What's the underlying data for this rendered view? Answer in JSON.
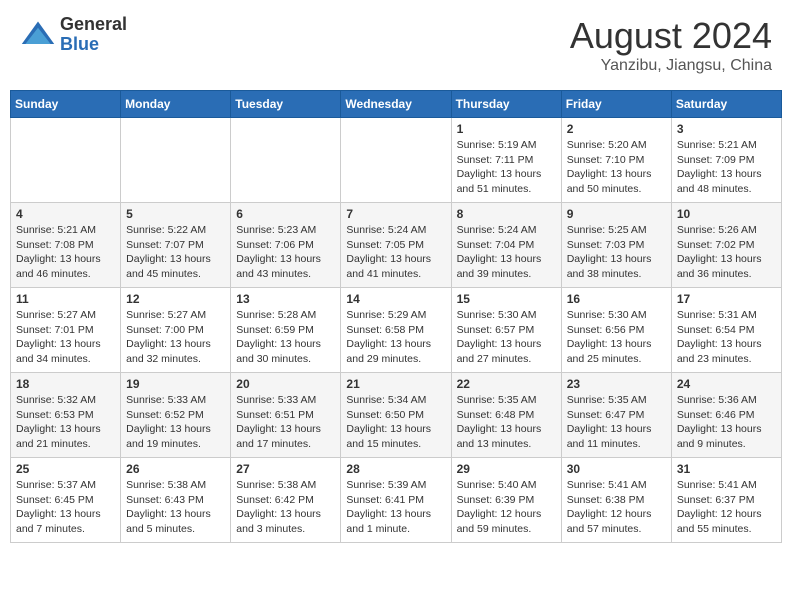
{
  "header": {
    "logo_general": "General",
    "logo_blue": "Blue",
    "month": "August 2024",
    "location": "Yanzibu, Jiangsu, China"
  },
  "weekdays": [
    "Sunday",
    "Monday",
    "Tuesday",
    "Wednesday",
    "Thursday",
    "Friday",
    "Saturday"
  ],
  "weeks": [
    [
      {
        "day": "",
        "info": ""
      },
      {
        "day": "",
        "info": ""
      },
      {
        "day": "",
        "info": ""
      },
      {
        "day": "",
        "info": ""
      },
      {
        "day": "1",
        "info": "Sunrise: 5:19 AM\nSunset: 7:11 PM\nDaylight: 13 hours\nand 51 minutes."
      },
      {
        "day": "2",
        "info": "Sunrise: 5:20 AM\nSunset: 7:10 PM\nDaylight: 13 hours\nand 50 minutes."
      },
      {
        "day": "3",
        "info": "Sunrise: 5:21 AM\nSunset: 7:09 PM\nDaylight: 13 hours\nand 48 minutes."
      }
    ],
    [
      {
        "day": "4",
        "info": "Sunrise: 5:21 AM\nSunset: 7:08 PM\nDaylight: 13 hours\nand 46 minutes."
      },
      {
        "day": "5",
        "info": "Sunrise: 5:22 AM\nSunset: 7:07 PM\nDaylight: 13 hours\nand 45 minutes."
      },
      {
        "day": "6",
        "info": "Sunrise: 5:23 AM\nSunset: 7:06 PM\nDaylight: 13 hours\nand 43 minutes."
      },
      {
        "day": "7",
        "info": "Sunrise: 5:24 AM\nSunset: 7:05 PM\nDaylight: 13 hours\nand 41 minutes."
      },
      {
        "day": "8",
        "info": "Sunrise: 5:24 AM\nSunset: 7:04 PM\nDaylight: 13 hours\nand 39 minutes."
      },
      {
        "day": "9",
        "info": "Sunrise: 5:25 AM\nSunset: 7:03 PM\nDaylight: 13 hours\nand 38 minutes."
      },
      {
        "day": "10",
        "info": "Sunrise: 5:26 AM\nSunset: 7:02 PM\nDaylight: 13 hours\nand 36 minutes."
      }
    ],
    [
      {
        "day": "11",
        "info": "Sunrise: 5:27 AM\nSunset: 7:01 PM\nDaylight: 13 hours\nand 34 minutes."
      },
      {
        "day": "12",
        "info": "Sunrise: 5:27 AM\nSunset: 7:00 PM\nDaylight: 13 hours\nand 32 minutes."
      },
      {
        "day": "13",
        "info": "Sunrise: 5:28 AM\nSunset: 6:59 PM\nDaylight: 13 hours\nand 30 minutes."
      },
      {
        "day": "14",
        "info": "Sunrise: 5:29 AM\nSunset: 6:58 PM\nDaylight: 13 hours\nand 29 minutes."
      },
      {
        "day": "15",
        "info": "Sunrise: 5:30 AM\nSunset: 6:57 PM\nDaylight: 13 hours\nand 27 minutes."
      },
      {
        "day": "16",
        "info": "Sunrise: 5:30 AM\nSunset: 6:56 PM\nDaylight: 13 hours\nand 25 minutes."
      },
      {
        "day": "17",
        "info": "Sunrise: 5:31 AM\nSunset: 6:54 PM\nDaylight: 13 hours\nand 23 minutes."
      }
    ],
    [
      {
        "day": "18",
        "info": "Sunrise: 5:32 AM\nSunset: 6:53 PM\nDaylight: 13 hours\nand 21 minutes."
      },
      {
        "day": "19",
        "info": "Sunrise: 5:33 AM\nSunset: 6:52 PM\nDaylight: 13 hours\nand 19 minutes."
      },
      {
        "day": "20",
        "info": "Sunrise: 5:33 AM\nSunset: 6:51 PM\nDaylight: 13 hours\nand 17 minutes."
      },
      {
        "day": "21",
        "info": "Sunrise: 5:34 AM\nSunset: 6:50 PM\nDaylight: 13 hours\nand 15 minutes."
      },
      {
        "day": "22",
        "info": "Sunrise: 5:35 AM\nSunset: 6:48 PM\nDaylight: 13 hours\nand 13 minutes."
      },
      {
        "day": "23",
        "info": "Sunrise: 5:35 AM\nSunset: 6:47 PM\nDaylight: 13 hours\nand 11 minutes."
      },
      {
        "day": "24",
        "info": "Sunrise: 5:36 AM\nSunset: 6:46 PM\nDaylight: 13 hours\nand 9 minutes."
      }
    ],
    [
      {
        "day": "25",
        "info": "Sunrise: 5:37 AM\nSunset: 6:45 PM\nDaylight: 13 hours\nand 7 minutes."
      },
      {
        "day": "26",
        "info": "Sunrise: 5:38 AM\nSunset: 6:43 PM\nDaylight: 13 hours\nand 5 minutes."
      },
      {
        "day": "27",
        "info": "Sunrise: 5:38 AM\nSunset: 6:42 PM\nDaylight: 13 hours\nand 3 minutes."
      },
      {
        "day": "28",
        "info": "Sunrise: 5:39 AM\nSunset: 6:41 PM\nDaylight: 13 hours\nand 1 minute."
      },
      {
        "day": "29",
        "info": "Sunrise: 5:40 AM\nSunset: 6:39 PM\nDaylight: 12 hours\nand 59 minutes."
      },
      {
        "day": "30",
        "info": "Sunrise: 5:41 AM\nSunset: 6:38 PM\nDaylight: 12 hours\nand 57 minutes."
      },
      {
        "day": "31",
        "info": "Sunrise: 5:41 AM\nSunset: 6:37 PM\nDaylight: 12 hours\nand 55 minutes."
      }
    ]
  ]
}
